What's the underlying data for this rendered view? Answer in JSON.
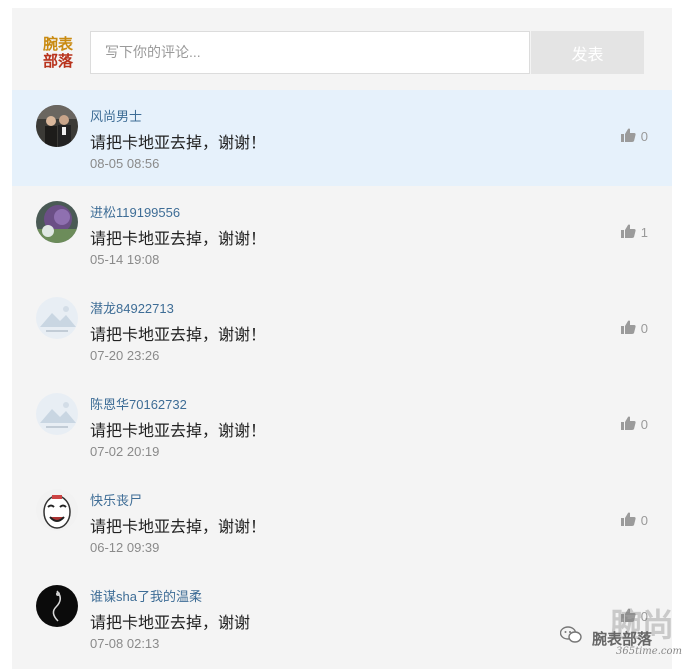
{
  "brand": {
    "line1": "腕表",
    "line2": "部落"
  },
  "composer": {
    "placeholder": "写下你的评论...",
    "submit_label": "发表"
  },
  "comments": [
    {
      "username": "风尚男士",
      "text": "请把卡地亚去掉，谢谢！",
      "time": "08-05 08:56",
      "likes": "0",
      "highlighted": true
    },
    {
      "username": "进松119199556",
      "text": "请把卡地亚去掉，谢谢！",
      "time": "05-14 19:08",
      "likes": "1",
      "highlighted": false
    },
    {
      "username": "潜龙84922713",
      "text": "请把卡地亚去掉，谢谢！",
      "time": "07-20 23:26",
      "likes": "0",
      "highlighted": false
    },
    {
      "username": "陈恩华70162732",
      "text": "请把卡地亚去掉，谢谢！",
      "time": "07-02 20:19",
      "likes": "0",
      "highlighted": false
    },
    {
      "username": "快乐丧尸",
      "text": "请把卡地亚去掉，谢谢！",
      "time": "06-12 09:39",
      "likes": "0",
      "highlighted": false
    },
    {
      "username": "谁谋sha了我的温柔",
      "text": "请把卡地亚去掉，谢谢",
      "time": "07-08 02:13",
      "likes": "0",
      "highlighted": false
    }
  ],
  "watermark": {
    "big": "腕尚",
    "text": "腕表部落",
    "url": "365time.com"
  },
  "icons": {
    "like": "thumbs-up-icon",
    "wechat": "wechat-icon"
  },
  "colors": {
    "highlight": "#e6f1fb",
    "username": "#3e6d96",
    "panel": "#f4f4f4"
  }
}
